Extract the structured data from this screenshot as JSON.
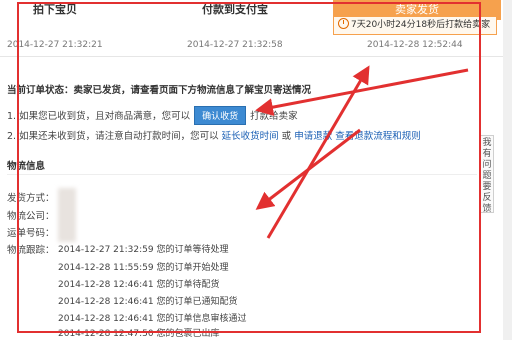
{
  "steps": [
    "拍下宝贝",
    "付款到支付宝",
    "卖家发货"
  ],
  "dates": [
    "2014-12-27 21:32:21",
    "2014-12-27 21:32:58",
    "2014-12-28 12:52:44"
  ],
  "countdown": "7天20小时24分18秒后打款给卖家",
  "status": {
    "label": "当前订单状态：",
    "text": "卖家已发货，请查看页面下方物流信息了解宝贝寄送情况",
    "line1_prefix": "1. 如果您已收到货，且对商品满意，您可以",
    "confirm_button": "确认收货",
    "line1_suffix": "打款给卖家",
    "line2_prefix": "2. 如果还未收到货，请注意自动打款时间，您可以",
    "link_extend": "延长收货时间",
    "or": "或",
    "link_refund": "申请退款",
    "link_process": "查看退款流程和规则"
  },
  "logistics": {
    "title": "物流信息",
    "ship_method_label": "发货方式：",
    "company_label": "物流公司：",
    "tracking_label": "运单号码：",
    "trace_label": "物流跟踪：",
    "entries": [
      {
        "time": "2014-12-27 21:32:59",
        "text": "您的订单等待处理"
      },
      {
        "time": "2014-12-28 11:55:59",
        "text": "您的订单开始处理"
      },
      {
        "time": "2014-12-28 12:46:41",
        "text": "您的订单待配货"
      },
      {
        "time": "2014-12-28 12:46:41",
        "text": "您的订单已通知配货"
      },
      {
        "time": "2014-12-28 12:46:41",
        "text": "您的订单信息审核通过"
      },
      {
        "time": "2014-12-28 12:47:50",
        "text": "您的包裹已出库"
      }
    ]
  },
  "side_tab": "我有问题要反馈",
  "colors": {
    "accent_orange": "#f6a14d",
    "annotation_red": "#e23030",
    "link_blue": "#1a5fb4",
    "button_blue": "#3d8ad2"
  }
}
